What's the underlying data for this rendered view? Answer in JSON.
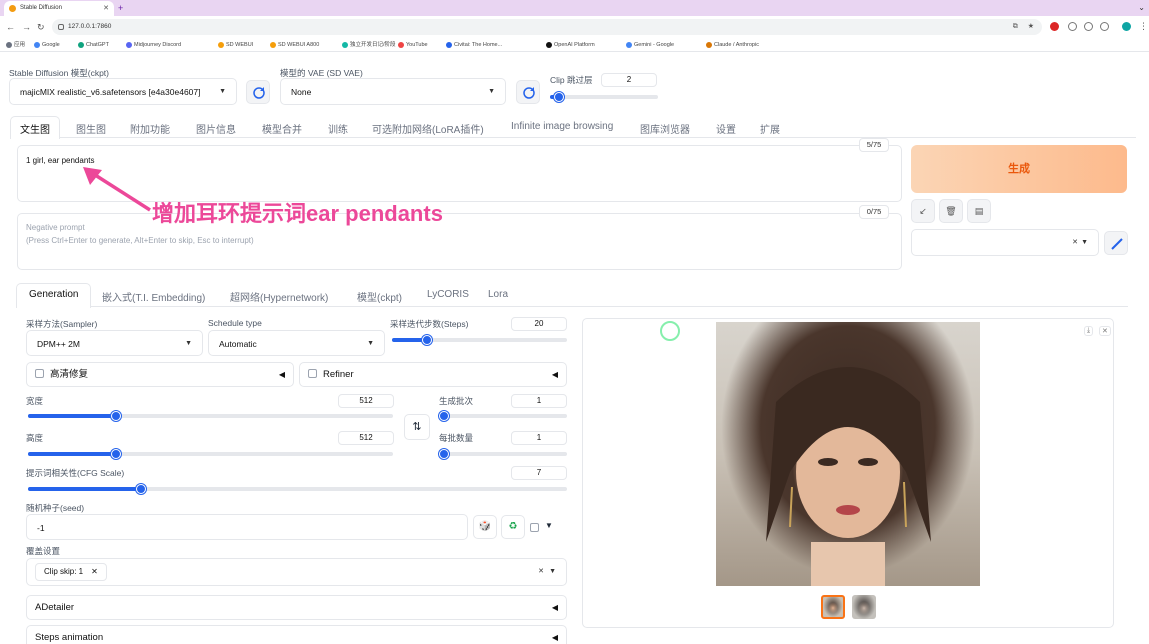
{
  "browser": {
    "tab_title": "Stable Diffusion",
    "url": "127.0.0.1:7860",
    "bookmarks": [
      "应用",
      "Google",
      "ChatGPT",
      "Midjourney Discord",
      "SD WEBUI",
      "SD WEBUI A800",
      "独立开发日记/阶段",
      "YouTube",
      "Civitai: The Home...",
      "OpenAI Platform",
      "Gemini - Google",
      "Claude / Anthropic"
    ]
  },
  "top": {
    "model_label": "Stable Diffusion 模型(ckpt)",
    "model_value": "majicMIX realistic_v6.safetensors [e4a30e4607]",
    "vae_label": "模型的 VAE (SD VAE)",
    "vae_value": "None",
    "clip_label": "Clip 跳过层",
    "clip_value": "2",
    "clip_fraction": 0.08
  },
  "main_tabs": [
    "文生图",
    "图生图",
    "附加功能",
    "图片信息",
    "模型合并",
    "训练",
    "可选附加网络(LoRA插件)",
    "Infinite image browsing",
    "图库浏览器",
    "设置",
    "扩展"
  ],
  "prompt": {
    "text": "1 girl, ear pendants",
    "counter": "5/75",
    "negative_placeholder": "Negative prompt",
    "negative_hint": "(Press Ctrl+Enter to generate, Alt+Enter to skip, Esc to interrupt)",
    "negative_counter": "0/75"
  },
  "annotation": "增加耳环提示词ear pendants",
  "generate_label": "生成",
  "sub_tabs": [
    "Generation",
    "嵌入式(T.I. Embedding)",
    "超网络(Hypernetwork)",
    "模型(ckpt)",
    "LyCORIS",
    "Lora"
  ],
  "sampler": {
    "label": "采样方法(Sampler)",
    "value": "DPM++ 2M"
  },
  "schedule": {
    "label": "Schedule type",
    "value": "Automatic"
  },
  "steps": {
    "label": "采样迭代步数(Steps)",
    "value": "20",
    "fraction": 0.2
  },
  "hires_label": "高清修复",
  "refiner_label": "Refiner",
  "width": {
    "label": "宽度",
    "value": "512",
    "fraction": 0.24
  },
  "height": {
    "label": "高度",
    "value": "512",
    "fraction": 0.24
  },
  "batch_count": {
    "label": "生成批次",
    "value": "1",
    "fraction": 0.02
  },
  "batch_size": {
    "label": "每批数量",
    "value": "1",
    "fraction": 0.02
  },
  "cfg": {
    "label": "提示词相关性(CFG Scale)",
    "value": "7",
    "fraction": 0.21
  },
  "seed": {
    "label": "随机种子(seed)",
    "value": "-1"
  },
  "override": {
    "label": "覆盖设置",
    "chip": "Clip skip: 1"
  },
  "accordions": [
    "ADetailer",
    "Steps animation"
  ],
  "icons": {
    "swap": "swap-icon",
    "dice": "dice-icon",
    "recycle": "recycle-icon"
  }
}
